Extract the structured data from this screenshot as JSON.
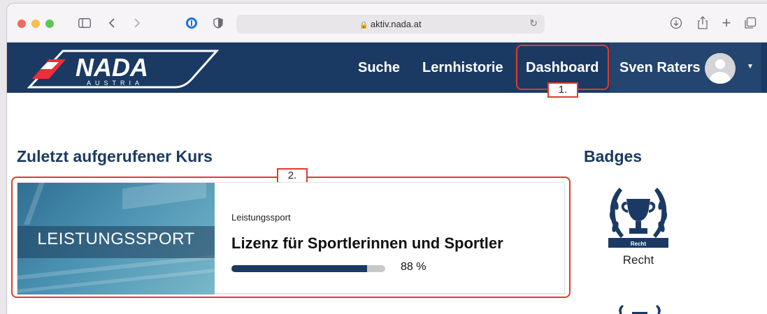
{
  "browser": {
    "url": "aktiv.nada.at",
    "icons": [
      "sidebar-icon",
      "back-icon",
      "forward-icon",
      "password-icon",
      "shield-icon",
      "reload-icon",
      "download-icon",
      "share-icon",
      "new-tab-icon",
      "tabs-overview-icon"
    ]
  },
  "nav": {
    "logo_text": "NADA",
    "logo_sub": "AUSTRIA",
    "links": [
      "Suche",
      "Lernhistorie",
      "Dashboard"
    ],
    "user_name": "Sven Raters"
  },
  "annotations": {
    "label_1": "1.",
    "label_2": "2.",
    "color": "#e23a2c"
  },
  "recent_course": {
    "heading": "Zuletzt aufgerufener Kurs",
    "image_text": "LEISTUNGSSPORT",
    "category": "Leistungssport",
    "title": "Lizenz für Sportlerinnen und Sportler",
    "progress_percent": 88,
    "progress_label": "88 %"
  },
  "badges": {
    "heading": "Badges",
    "items": [
      {
        "label": "Recht",
        "ribbon": "Recht"
      }
    ]
  },
  "colors": {
    "brand": "#1b3a63",
    "accent_red": "#e23a2c"
  }
}
